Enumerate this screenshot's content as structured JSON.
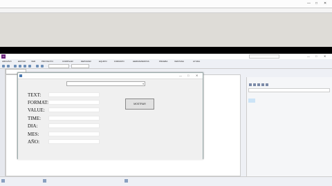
{
  "background_window": {
    "title": "",
    "controls": [
      "—",
      "□",
      "✕"
    ],
    "toolbar_items": [
      "",
      "",
      "",
      ""
    ]
  },
  "vs": {
    "title": "",
    "search_placeholder": "",
    "window_controls": [
      "—",
      "□",
      "✕"
    ],
    "menu": [
      "ARCHIVO",
      "EDITAR",
      "VER",
      "PROYECTO",
      "COMPILAR",
      "DEPURAR",
      "EQUIPO",
      "FORMATO",
      "HERRAMIENTAS",
      "PRUEBA",
      "VENTANA",
      "AYUDA"
    ],
    "toolbar": {
      "start_label": "",
      "config_label": ""
    },
    "doc_tab": "",
    "bottom_tabs": [
      "",
      "",
      ""
    ]
  },
  "form": {
    "title": "",
    "controls": [
      "—",
      "□",
      "✕"
    ],
    "date_picker_value": "",
    "rows": [
      {
        "label": "TEXT:",
        "value": ""
      },
      {
        "label": "FORMAT:",
        "value": ""
      },
      {
        "label": "VALUE:",
        "value": ""
      },
      {
        "label": "TIME:",
        "value": ""
      },
      {
        "label": "DIA:",
        "value": ""
      },
      {
        "label": "MES:",
        "value": ""
      },
      {
        "label": "AÑO:",
        "value": ""
      }
    ],
    "button": "MOSTRAR"
  },
  "solution_explorer": {
    "title": "",
    "search_placeholder": "",
    "items": [
      "",
      "",
      "",
      "",
      ""
    ]
  }
}
